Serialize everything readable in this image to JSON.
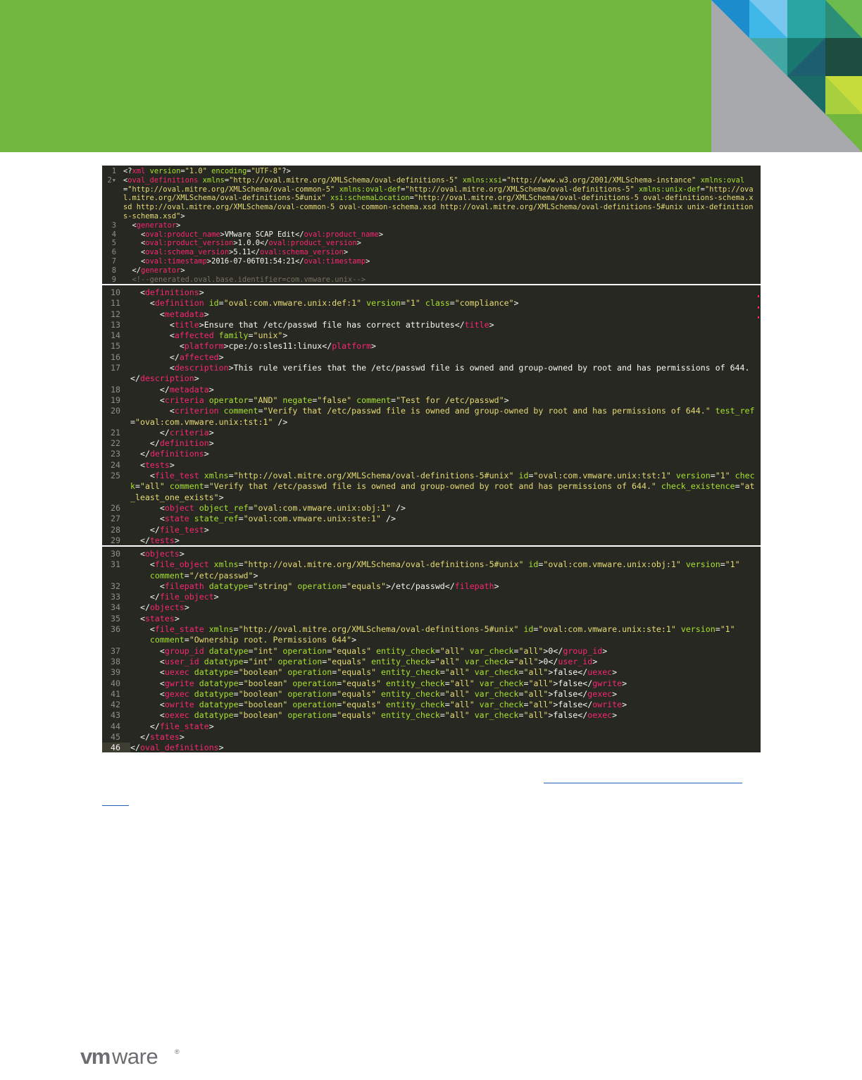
{
  "brand": {
    "logo_text": "vmware",
    "colors": {
      "header_green": "#71b63f",
      "code_background": "#272822",
      "tag": "#f92672",
      "attribute": "#a6e22e",
      "string": "#e6db74",
      "comment": "#75715e",
      "line_number": "#8f908a"
    }
  },
  "panels": [
    {
      "id": "xml-header",
      "lines": [
        {
          "n": "1",
          "html": "&lt;?<span class=\"tag\">xml</span> <span class=\"attr\">version</span>=<span class=\"str\">\"1.0\"</span> <span class=\"attr\">encoding</span>=<span class=\"str\">\"UTF-8\"</span>?&gt;"
        },
        {
          "n": "2▾",
          "html": "&lt;<span class=\"tag\">oval_definitions</span> <span class=\"attr\">xmlns</span>=<span class=\"str\">\"http://oval.mitre.org/XMLSchema/oval-definitions-5\"</span> <span class=\"attr\">xmlns:xsi</span>=<span class=\"str\">\"http://www.w3.org/2001/XMLSchema-instance\"</span> <span class=\"attr\">xmlns:oval</span>=<span class=\"str\">\"http://oval.mitre.org/XMLSchema/oval-common-5\"</span> <span class=\"attr\">xmlns:oval-def</span>=<span class=\"str\">\"http://oval.mitre.org/XMLSchema/oval-definitions-5\"</span> <span class=\"attr\">xmlns:unix-def</span>=<span class=\"str\">\"http://oval.mitre.org/XMLSchema/oval-definitions-5#unix\"</span> <span class=\"attr\">xsi:schemaLocation</span>=<span class=\"str\">\"http://oval.mitre.org/XMLSchema/oval-definitions-5 oval-definitions-schema.xsd http://oval.mitre.org/XMLSchema/oval-common-5 oval-common-schema.xsd http://oval.mitre.org/XMLSchema/oval-definitions-5#unix unix-definitions-schema.xsd\"</span>&gt;"
        },
        {
          "n": "3",
          "html": "  &lt;<span class=\"tag\">generator</span>&gt;"
        },
        {
          "n": "4",
          "html": "    &lt;<span class=\"tag\">oval:product_name</span>&gt;VMware SCAP Edit&lt;/<span class=\"tag\">oval:product_name</span>&gt;"
        },
        {
          "n": "5",
          "html": "    &lt;<span class=\"tag\">oval:product_version</span>&gt;1.0.0&lt;/<span class=\"tag\">oval:product_version</span>&gt;"
        },
        {
          "n": "6",
          "html": "    &lt;<span class=\"tag\">oval:schema_version</span>&gt;5.11&lt;/<span class=\"tag\">oval:schema_version</span>&gt;"
        },
        {
          "n": "7",
          "html": "    &lt;<span class=\"tag\">oval:timestamp</span>&gt;2016-07-06T01:54:21&lt;/<span class=\"tag\">oval:timestamp</span>&gt;"
        },
        {
          "n": "8",
          "html": "  &lt;/<span class=\"tag\">generator</span>&gt;"
        },
        {
          "n": "9",
          "html": "  <span class=\"cmt\">&lt;!--generated.oval.base.identifier=com.vmware.unix--&gt;</span>"
        }
      ]
    },
    {
      "id": "definitions-tests",
      "lines": [
        {
          "n": "10",
          "html": "  &lt;<span class=\"tag\">definitions</span>&gt;"
        },
        {
          "n": "11",
          "html": "    &lt;<span class=\"tag\">definition</span> <span class=\"attr\">id</span>=<span class=\"str\">\"oval:com.vmware.unix:def:1\"</span> <span class=\"attr\">version</span>=<span class=\"str\">\"1\"</span> <span class=\"attr\">class</span>=<span class=\"str\">\"compliance\"</span>&gt;"
        },
        {
          "n": "12",
          "html": "      &lt;<span class=\"tag\">metadata</span>&gt;"
        },
        {
          "n": "13",
          "html": "        &lt;<span class=\"tag\">title</span>&gt;Ensure that /etc/passwd file has correct attributes&lt;/<span class=\"tag\">title</span>&gt;"
        },
        {
          "n": "14",
          "html": "        &lt;<span class=\"tag\">affected</span> <span class=\"attr\">family</span>=<span class=\"str\">\"unix\"</span>&gt;"
        },
        {
          "n": "15",
          "html": "          &lt;<span class=\"tag\">platform</span>&gt;cpe:/o:sles11:linux&lt;/<span class=\"tag\">platform</span>&gt;"
        },
        {
          "n": "16",
          "html": "        &lt;/<span class=\"tag\">affected</span>&gt;"
        },
        {
          "n": "17",
          "html": "        &lt;<span class=\"tag\">description</span>&gt;This rule verifies that the /etc/passwd file is owned and group-owned by root and has permissions of 644.&lt;/<span class=\"tag\">description</span>&gt;"
        },
        {
          "n": "18",
          "html": "      &lt;/<span class=\"tag\">metadata</span>&gt;"
        },
        {
          "n": "19",
          "html": "      &lt;<span class=\"tag\">criteria</span> <span class=\"attr\">operator</span>=<span class=\"str\">\"AND\"</span> <span class=\"attr\">negate</span>=<span class=\"str\">\"false\"</span> <span class=\"attr\">comment</span>=<span class=\"str\">\"Test for /etc/passwd\"</span>&gt;"
        },
        {
          "n": "20",
          "html": "        &lt;<span class=\"tag\">criterion</span> <span class=\"attr\">comment</span>=<span class=\"str\">\"Verify that /etc/passwd file is owned and group-owned by root and has permissions of 644.\"</span> <span class=\"attr\">test_ref</span>=<span class=\"str\">\"oval:com.vmware.unix:tst:1\"</span> /&gt;"
        },
        {
          "n": "21",
          "html": "      &lt;/<span class=\"tag\">criteria</span>&gt;"
        },
        {
          "n": "22",
          "html": "    &lt;/<span class=\"tag\">definition</span>&gt;"
        },
        {
          "n": "23",
          "html": "  &lt;/<span class=\"tag\">definitions</span>&gt;"
        },
        {
          "n": "24",
          "html": "  &lt;<span class=\"tag\">tests</span>&gt;"
        },
        {
          "n": "25",
          "html": "    &lt;<span class=\"tag\">file_test</span> <span class=\"attr\">xmlns</span>=<span class=\"str\">\"http://oval.mitre.org/XMLSchema/oval-definitions-5#unix\"</span> <span class=\"attr\">id</span>=<span class=\"str\">\"oval:com.vmware.unix:tst:1\"</span> <span class=\"attr\">version</span>=<span class=\"str\">\"1\"</span> <span class=\"attr\">check</span>=<span class=\"str\">\"all\"</span> <span class=\"attr\">comment</span>=<span class=\"str\">\"Verify that /etc/passwd file is owned and group-owned by root and has permissions of 644.\"</span> <span class=\"attr\">check_existence</span>=<span class=\"str\">\"at_least_one_exists\"</span>&gt;"
        },
        {
          "n": "26",
          "html": "      &lt;<span class=\"tag\">object</span> <span class=\"attr\">object_ref</span>=<span class=\"str\">\"oval:com.vmware.unix:obj:1\"</span> /&gt;"
        },
        {
          "n": "27",
          "html": "      &lt;<span class=\"tag\">state</span> <span class=\"attr\">state_ref</span>=<span class=\"str\">\"oval:com.vmware.unix:ste:1\"</span> /&gt;"
        },
        {
          "n": "28",
          "html": "    &lt;/<span class=\"tag\">file_test</span>&gt;"
        },
        {
          "n": "29",
          "html": "  &lt;/<span class=\"tag\">tests</span>&gt;"
        }
      ]
    },
    {
      "id": "objects-states",
      "lines": [
        {
          "n": "30",
          "html": "  &lt;<span class=\"tag\">objects</span>&gt;"
        },
        {
          "n": "31",
          "html": "    &lt;<span class=\"tag\">file_object</span> <span class=\"attr\">xmlns</span>=<span class=\"str\">\"http://oval.mitre.org/XMLSchema/oval-definitions-5#unix\"</span> <span class=\"attr\">id</span>=<span class=\"str\">\"oval:com.vmware.unix:obj:1\"</span> <span class=\"attr\">version</span>=<span class=\"str\">\"1\"</span>\n    <span class=\"attr\">comment</span>=<span class=\"str\">\"/etc/passwd\"</span>&gt;"
        },
        {
          "n": "32",
          "html": "      &lt;<span class=\"tag\">filepath</span> <span class=\"attr\">datatype</span>=<span class=\"str\">\"string\"</span> <span class=\"attr\">operation</span>=<span class=\"str\">\"equals\"</span>&gt;/etc/passwd&lt;/<span class=\"tag\">filepath</span>&gt;"
        },
        {
          "n": "33",
          "html": "    &lt;/<span class=\"tag\">file_object</span>&gt;"
        },
        {
          "n": "34",
          "html": "  &lt;/<span class=\"tag\">objects</span>&gt;"
        },
        {
          "n": "35",
          "html": "  &lt;<span class=\"tag\">states</span>&gt;"
        },
        {
          "n": "36",
          "html": "    &lt;<span class=\"tag\">file_state</span> <span class=\"attr\">xmlns</span>=<span class=\"str\">\"http://oval.mitre.org/XMLSchema/oval-definitions-5#unix\"</span> <span class=\"attr\">id</span>=<span class=\"str\">\"oval:com.vmware.unix:ste:1\"</span> <span class=\"attr\">version</span>=<span class=\"str\">\"1\"</span>\n    <span class=\"attr\">comment</span>=<span class=\"str\">\"Ownership root. Permissions 644\"</span>&gt;"
        },
        {
          "n": "37",
          "html": "      &lt;<span class=\"tag\">group_id</span> <span class=\"attr\">datatype</span>=<span class=\"str\">\"int\"</span> <span class=\"attr\">operation</span>=<span class=\"str\">\"equals\"</span> <span class=\"attr\">entity_check</span>=<span class=\"str\">\"all\"</span> <span class=\"attr\">var_check</span>=<span class=\"str\">\"all\"</span>&gt;0&lt;/<span class=\"tag\">group_id</span>&gt;"
        },
        {
          "n": "38",
          "html": "      &lt;<span class=\"tag\">user_id</span> <span class=\"attr\">datatype</span>=<span class=\"str\">\"int\"</span> <span class=\"attr\">operation</span>=<span class=\"str\">\"equals\"</span> <span class=\"attr\">entity_check</span>=<span class=\"str\">\"all\"</span> <span class=\"attr\">var_check</span>=<span class=\"str\">\"all\"</span>&gt;0&lt;/<span class=\"tag\">user_id</span>&gt;"
        },
        {
          "n": "39",
          "html": "      &lt;<span class=\"tag\">uexec</span> <span class=\"attr\">datatype</span>=<span class=\"str\">\"boolean\"</span> <span class=\"attr\">operation</span>=<span class=\"str\">\"equals\"</span> <span class=\"attr\">entity_check</span>=<span class=\"str\">\"all\"</span> <span class=\"attr\">var_check</span>=<span class=\"str\">\"all\"</span>&gt;false&lt;/<span class=\"tag\">uexec</span>&gt;"
        },
        {
          "n": "40",
          "html": "      &lt;<span class=\"tag\">gwrite</span> <span class=\"attr\">datatype</span>=<span class=\"str\">\"boolean\"</span> <span class=\"attr\">operation</span>=<span class=\"str\">\"equals\"</span> <span class=\"attr\">entity_check</span>=<span class=\"str\">\"all\"</span> <span class=\"attr\">var_check</span>=<span class=\"str\">\"all\"</span>&gt;false&lt;/<span class=\"tag\">gwrite</span>&gt;"
        },
        {
          "n": "41",
          "html": "      &lt;<span class=\"tag\">gexec</span> <span class=\"attr\">datatype</span>=<span class=\"str\">\"boolean\"</span> <span class=\"attr\">operation</span>=<span class=\"str\">\"equals\"</span> <span class=\"attr\">entity_check</span>=<span class=\"str\">\"all\"</span> <span class=\"attr\">var_check</span>=<span class=\"str\">\"all\"</span>&gt;false&lt;/<span class=\"tag\">gexec</span>&gt;"
        },
        {
          "n": "42",
          "html": "      &lt;<span class=\"tag\">owrite</span> <span class=\"attr\">datatype</span>=<span class=\"str\">\"boolean\"</span> <span class=\"attr\">operation</span>=<span class=\"str\">\"equals\"</span> <span class=\"attr\">entity_check</span>=<span class=\"str\">\"all\"</span> <span class=\"attr\">var_check</span>=<span class=\"str\">\"all\"</span>&gt;false&lt;/<span class=\"tag\">owrite</span>&gt;"
        },
        {
          "n": "43",
          "html": "      &lt;<span class=\"tag\">oexec</span> <span class=\"attr\">datatype</span>=<span class=\"str\">\"boolean\"</span> <span class=\"attr\">operation</span>=<span class=\"str\">\"equals\"</span> <span class=\"attr\">entity_check</span>=<span class=\"str\">\"all\"</span> <span class=\"attr\">var_check</span>=<span class=\"str\">\"all\"</span>&gt;false&lt;/<span class=\"tag\">oexec</span>&gt;"
        },
        {
          "n": "44",
          "html": "    &lt;/<span class=\"tag\">file_state</span>&gt;"
        },
        {
          "n": "45",
          "html": "  &lt;/<span class=\"tag\">states</span>&gt;"
        },
        {
          "n": "46",
          "html": "&lt;/<span class=\"tag\">oval_definitions</span>&gt;",
          "active": true
        }
      ]
    }
  ]
}
